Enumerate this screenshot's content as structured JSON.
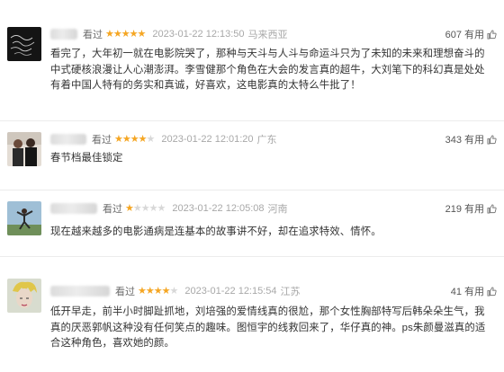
{
  "reviews": [
    {
      "watched": "看过",
      "rating": 5,
      "time": "2023-01-22 12:13:50",
      "location": "马来西亚",
      "votes": "607 有用",
      "content": "看完了，大年初一就在电影院哭了，那种与天斗与人斗与命运斗只为了未知的未来和理想奋斗的中式硬核浪漫让人心潮澎湃。李雪健那个角色在大会的发言真的超牛，大刘笔下的科幻真是处处有着中国人特有的务实和真诚，好喜欢，这电影真的太特么牛批了！"
    },
    {
      "watched": "看过",
      "rating": 4,
      "time": "2023-01-22 12:01:20",
      "location": "广东",
      "votes": "343 有用",
      "content": "春节档最佳锁定"
    },
    {
      "watched": "看过",
      "rating": 1,
      "time": "2023-01-22 12:05:08",
      "location": "河南",
      "votes": "219 有用",
      "content": "现在越来越多的电影通病是连基本的故事讲不好，却在追求特效、情怀。"
    },
    {
      "watched": "看过",
      "rating": 4,
      "time": "2023-01-22 12:15:54",
      "location": "江苏",
      "votes": "41 有用",
      "content": "低开早走，前半小时脚趾抓地，刘培强的爱情线真的很尬，那个女性胸部特写后韩朵朵生气，我真的厌恶郭帆这种没有任何笑点的趣味。图恒宇的线救回来了，华仔真的神。ps朱颜曼滋真的适合这种角色，喜欢她的颜。"
    }
  ],
  "colors": {
    "star_on": "#f5a623",
    "star_off": "#d8d8d8",
    "meta_gray": "#a8a8a8"
  },
  "icons": {
    "star": "star-icon",
    "useful": "thumbs-up-icon"
  }
}
